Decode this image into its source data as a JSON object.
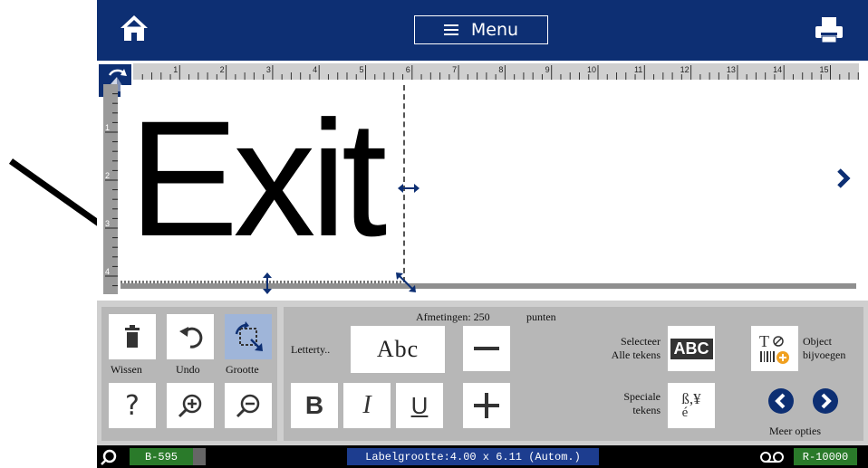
{
  "topbar": {
    "menu_label": "Menu"
  },
  "canvas": {
    "label_text": "Exit",
    "ruler_top_numbers": [
      "1",
      "2",
      "3",
      "4",
      "5",
      "6",
      "7",
      "8",
      "9",
      "10",
      "11",
      "12",
      "13",
      "14",
      "15"
    ],
    "ruler_left_numbers": [
      "1",
      "2",
      "3",
      "4"
    ]
  },
  "toolbar_left": {
    "wissen_label": "Wissen",
    "undo_label": "Undo",
    "grootte_label": "Grootte",
    "help_glyph": "?"
  },
  "toolbar_right": {
    "afmetingen_label": "Afmetingen: 250",
    "punten_label": "punten",
    "lettertype_label": "Letterty..",
    "font_sample": "Abc",
    "bold_glyph": "B",
    "italic_glyph": "I",
    "underline_glyph": "U",
    "selecteer_line1": "Selecteer",
    "selecteer_line2": "Alle tekens",
    "abc_badge": "ABC",
    "object_line1": "Object",
    "object_line2": "bijvoegen",
    "speciale_line1": "Speciale",
    "speciale_line2": "tekens",
    "special_glyph": "ß,¥",
    "special_glyph2": "é",
    "meer_opties": "Meer opties"
  },
  "statusbar": {
    "ribbon_left": "B-595",
    "label_size": "Labelgrootte:4.00 x 6.11 (Autom.)",
    "ribbon_right": "R-10000"
  },
  "colors": {
    "brand": "#0d2f73",
    "status_green": "#2a7a2a",
    "status_blue": "#1d3d8f"
  }
}
